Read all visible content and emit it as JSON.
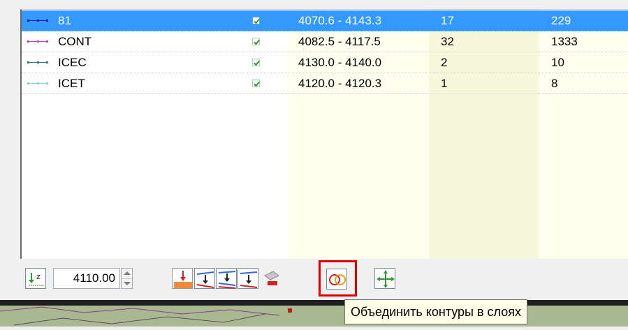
{
  "layers_table": {
    "rows": [
      {
        "name": "81",
        "visible": true,
        "range": "4070.6 - 4143.3",
        "count": "17",
        "points": "229",
        "line_color": "#1a1aa6",
        "selected": true
      },
      {
        "name": "CONT",
        "visible": true,
        "range": "4082.5 - 4117.5",
        "count": "32",
        "points": "1333",
        "line_color": "#d23ad2",
        "selected": false
      },
      {
        "name": "ICEC",
        "visible": true,
        "range": "4130.0 - 4140.0",
        "count": "2",
        "points": "10",
        "line_color": "#2a7a7a",
        "selected": false
      },
      {
        "name": "ICET",
        "visible": true,
        "range": "4120.0 - 4120.3",
        "count": "1",
        "points": "8",
        "line_color": "#7ad6d6",
        "selected": false
      }
    ]
  },
  "toolbar": {
    "z_value": "4110.00",
    "buttons": [
      {
        "icon": "sort-z-icon"
      },
      {
        "icon": "surface-down-icon"
      },
      {
        "icon": "project-down-icon"
      },
      {
        "icon": "project-down-multi-icon"
      },
      {
        "icon": "erase-layer-icon"
      },
      {
        "icon": "merge-contours-icon",
        "highlighted": true
      },
      {
        "icon": "move-icon"
      }
    ]
  },
  "tooltip": {
    "text": "Объединить контуры в слоях"
  },
  "colors": {
    "selection": "#3399ff",
    "column_tint_1": "#fffff0",
    "column_tint_2": "#f7f7dc",
    "highlight_border": "#e00000",
    "check_green": "#2e9a2e"
  }
}
